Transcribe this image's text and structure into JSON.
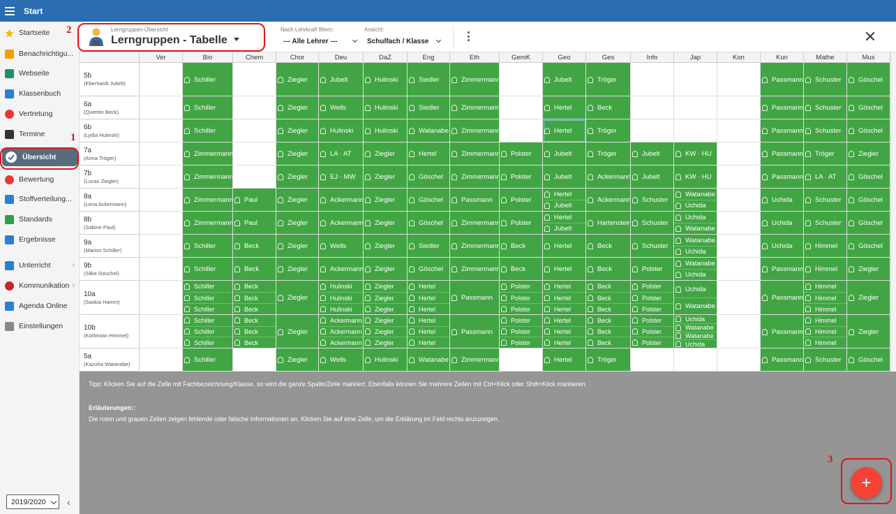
{
  "app": {
    "title": "Start"
  },
  "sidebar": {
    "items": [
      {
        "label": "Startseite",
        "icon": "star-icon",
        "color": "#f5b800"
      },
      {
        "label": "Benachrichtigu...",
        "icon": "envelope-icon",
        "color": "#f5a000"
      },
      {
        "label": "Webseite",
        "icon": "home-icon",
        "color": "#1f8f6f"
      },
      {
        "label": "Klassenbuch",
        "icon": "book-icon",
        "color": "#2a7fd0"
      },
      {
        "label": "Vertretung",
        "icon": "person-swap-icon",
        "color": "#e53935"
      },
      {
        "label": "Termine",
        "icon": "calendar-icon",
        "color": "#333333"
      },
      {
        "label": "Übersicht",
        "icon": "check-circle-icon",
        "color": "#ffffff",
        "active": true
      },
      {
        "label": "Bewertung",
        "icon": "grade-icon",
        "color": "#e53935"
      },
      {
        "label": "Stoffverteilung...",
        "icon": "layers-icon",
        "color": "#2a7fd0"
      },
      {
        "label": "Standards",
        "icon": "shield-icon",
        "color": "#2e9e47"
      },
      {
        "label": "Ergebnisse",
        "icon": "bar-chart-icon",
        "color": "#2a7fd0"
      },
      {
        "label": "Unterricht",
        "icon": "class-icon",
        "color": "#2a7fd0",
        "submenu": true
      },
      {
        "label": "Kommunikation",
        "icon": "chat-icon",
        "color": "#c62828",
        "submenu": true
      },
      {
        "label": "Agenda Online",
        "icon": "pen-icon",
        "color": "#2a7fd0"
      },
      {
        "label": "Einstellungen",
        "icon": "gear-icon",
        "color": "#888888"
      }
    ],
    "year": "2019/2020"
  },
  "toolbar": {
    "small_title": "Lerngruppen-Übersicht",
    "main_title": "Lerngruppen - Tabelle",
    "filter_label": "Nach Lehrkraft filtern:",
    "filter_value": "--- Alle Lehrer ---",
    "view_label": "Ansicht:",
    "view_value": "Schulfach / Klasse"
  },
  "annotations": [
    "1",
    "2",
    "3"
  ],
  "table": {
    "columns": [
      "Ver",
      "Bio",
      "Chem",
      "Chor",
      "Deu",
      "DaZ",
      "Eng",
      "Eth",
      "GemK",
      "Geo",
      "Ges",
      "Info",
      "Jap",
      "Kon",
      "Kun",
      "Mathe",
      "Mus"
    ],
    "rows": [
      {
        "class": "5b",
        "teacher": "(Eberhardt Jubelt)",
        "cells": [
          [],
          [
            "Schiller"
          ],
          [],
          [
            "Ziegler"
          ],
          [
            "Jubelt"
          ],
          [
            "Hulinski"
          ],
          [
            "Siedler"
          ],
          [
            "Zimmermann"
          ],
          [],
          [
            "Jubelt"
          ],
          [
            "Tröger"
          ],
          [],
          [],
          [],
          [
            "Passmann"
          ],
          [
            "Schuster"
          ],
          [
            "Göschel"
          ]
        ]
      },
      {
        "class": "6a",
        "teacher": "(Quentin Beck)",
        "cells": [
          [],
          [
            "Schiller"
          ],
          [],
          [
            "Ziegler"
          ],
          [
            "Wells"
          ],
          [
            "Hulinski"
          ],
          [
            "Siedler"
          ],
          [
            "Zimmermann"
          ],
          [],
          [
            "Hertel"
          ],
          [
            "Beck"
          ],
          [],
          [],
          [],
          [
            "Passmann"
          ],
          [
            "Schuster"
          ],
          [
            "Göschel"
          ]
        ]
      },
      {
        "class": "6b",
        "teacher": "(Lydia Hulinski)",
        "cells": [
          [],
          [
            "Schiller"
          ],
          [],
          [
            "Ziegler"
          ],
          [
            "Hulinski"
          ],
          [
            "Hulinski"
          ],
          [
            "Watanabe"
          ],
          [
            "Zimmermann"
          ],
          [],
          [
            "Hertel"
          ],
          [
            "Tröger"
          ],
          [],
          [],
          [],
          [
            "Passmann"
          ],
          [
            "Schuster"
          ],
          [
            "Göschel"
          ]
        ]
      },
      {
        "class": "7a",
        "teacher": "(Anna Tröger)",
        "cells": [
          [],
          [
            "Zimmermann"
          ],
          [],
          [
            "Ziegler"
          ],
          [
            "LA · AT"
          ],
          [
            "Ziegler"
          ],
          [
            "Hertel"
          ],
          [
            "Zimmermann"
          ],
          [
            "Polster"
          ],
          [
            "Jubelt"
          ],
          [
            "Tröger"
          ],
          [
            "Jubelt"
          ],
          [
            "KW · HU"
          ],
          [],
          [
            "Passmann"
          ],
          [
            "Tröger"
          ],
          [
            "Ziegler"
          ]
        ]
      },
      {
        "class": "7b",
        "teacher": "(Lucas Ziegler)",
        "cells": [
          [],
          [
            "Zimmermann"
          ],
          [],
          [
            "Ziegler"
          ],
          [
            "EJ · MW"
          ],
          [
            "Ziegler"
          ],
          [
            "Göschel"
          ],
          [
            "Zimmermann"
          ],
          [
            "Polster"
          ],
          [
            "Jubelt"
          ],
          [
            "Ackermann"
          ],
          [
            "Jubelt"
          ],
          [
            "KW · HU"
          ],
          [],
          [
            "Passmann"
          ],
          [
            "LA · AT"
          ],
          [
            "Göschel"
          ]
        ]
      },
      {
        "class": "8a",
        "teacher": "(Lena Ackermann)",
        "cells": [
          [],
          [
            "Zimmermann"
          ],
          [
            "Paul"
          ],
          [
            "Ziegler"
          ],
          [
            "Ackermann"
          ],
          [
            "Ziegler"
          ],
          [
            "Göschel"
          ],
          [
            "Passmann"
          ],
          [
            "Polster"
          ],
          [
            "Hertel",
            "Jubelt"
          ],
          [
            "Ackermann"
          ],
          [
            "Schuster"
          ],
          [
            "Watanabe",
            "Uchida"
          ],
          [],
          [
            "Uchida"
          ],
          [
            "Schuster"
          ],
          [
            "Göschel"
          ]
        ]
      },
      {
        "class": "8b",
        "teacher": "(Sabine Paul)",
        "cells": [
          [],
          [
            "Zimmermann"
          ],
          [
            "Paul"
          ],
          [
            "Ziegler"
          ],
          [
            "Ackermann"
          ],
          [
            "Ziegler"
          ],
          [
            "Göschel"
          ],
          [
            "Zimmermann"
          ],
          [
            "Polster"
          ],
          [
            "Hertel",
            "Jubelt"
          ],
          [
            "Hartenstein"
          ],
          [
            "Schuster"
          ],
          [
            "Uchida",
            "Watanabe"
          ],
          [],
          [
            "Uchida"
          ],
          [
            "Schuster"
          ],
          [
            "Göschel"
          ]
        ]
      },
      {
        "class": "9a",
        "teacher": "(Marion Schiller)",
        "cells": [
          [],
          [
            "Schiller"
          ],
          [
            "Beck"
          ],
          [
            "Ziegler"
          ],
          [
            "Wells"
          ],
          [
            "Ziegler"
          ],
          [
            "Siedler"
          ],
          [
            "Zimmermann"
          ],
          [
            "Beck"
          ],
          [
            "Hertel"
          ],
          [
            "Beck"
          ],
          [
            "Schuster"
          ],
          [
            "Watanabe",
            "Uchida"
          ],
          [],
          [
            "Uchida"
          ],
          [
            "Himmel"
          ],
          [
            "Göschel"
          ]
        ]
      },
      {
        "class": "9b",
        "teacher": "(Silke Göschel)",
        "cells": [
          [],
          [
            "Schiller"
          ],
          [
            "Beck"
          ],
          [
            "Ziegler"
          ],
          [
            "Ackermann"
          ],
          [
            "Ziegler"
          ],
          [
            "Göschel"
          ],
          [
            "Zimmermann"
          ],
          [
            "Beck"
          ],
          [
            "Hertel"
          ],
          [
            "Beck"
          ],
          [
            "Polster"
          ],
          [
            "Watanabe",
            "Uchida"
          ],
          [],
          [
            "Passmann"
          ],
          [
            "Himmel"
          ],
          [
            "Ziegler"
          ]
        ]
      },
      {
        "class": "10a",
        "teacher": "(Saskia Hamm)",
        "cells": [
          [],
          [
            "Schiller",
            "Schiller",
            "Schiller"
          ],
          [
            "Beck",
            "Beck",
            "Beck"
          ],
          [
            "Ziegler"
          ],
          [
            "Hulinski",
            "Hulinski",
            "Hulinski"
          ],
          [
            "Ziegler",
            "Ziegler",
            "Ziegler"
          ],
          [
            "Hertel",
            "Hertel",
            "Hertel"
          ],
          [
            "Passmann"
          ],
          [
            "Polster",
            "Polster",
            "Polster"
          ],
          [
            "Hertel",
            "Hertel",
            "Hertel"
          ],
          [
            "Beck",
            "Beck",
            "Beck"
          ],
          [
            "Polster",
            "Polster",
            "Polster"
          ],
          [
            "Uchida",
            "Watanabe"
          ],
          [],
          [
            "Passmann"
          ],
          [
            "Himmel",
            "Himmel",
            "Himmel"
          ],
          [
            "Ziegler"
          ]
        ]
      },
      {
        "class": "10b",
        "teacher": "(Korbinian Himmel)",
        "cells": [
          [],
          [
            "Schiller",
            "Schiller",
            "Schiller"
          ],
          [
            "Beck",
            "Beck",
            "Beck"
          ],
          [
            "Ziegler"
          ],
          [
            "Ackermann",
            "Ackermann",
            "Ackermann"
          ],
          [
            "Ziegler",
            "Ziegler",
            "Ziegler"
          ],
          [
            "Hertel",
            "Hertel",
            "Hertel"
          ],
          [
            "Passmann"
          ],
          [
            "Polster",
            "Polster",
            "Polster"
          ],
          [
            "Hertel",
            "Hertel",
            "Hertel"
          ],
          [
            "Beck",
            "Beck",
            "Beck"
          ],
          [
            "Polster",
            "Polster",
            "Polster"
          ],
          [
            "Uchida",
            "Watanabe",
            "Watanabe",
            "Uchida"
          ],
          [],
          [
            "Passmann"
          ],
          [
            "Himmel",
            "Himmel",
            "Himmel"
          ],
          [
            "Ziegler"
          ]
        ]
      },
      {
        "class": "5a",
        "teacher": "(Kazuha Watanabe)",
        "cells": [
          [],
          [
            "Schiller"
          ],
          [],
          [
            "Ziegler"
          ],
          [
            "Wells"
          ],
          [
            "Hulinski"
          ],
          [
            "Watanabe"
          ],
          [
            "Zimmermann"
          ],
          [],
          [
            "Hertel"
          ],
          [
            "Tröger"
          ],
          [],
          [],
          [],
          [
            "Passmann"
          ],
          [
            "Schuster"
          ],
          [
            "Göschel"
          ]
        ]
      }
    ]
  },
  "info": {
    "tip": "Tipp: Klicken Sie auf die Zelle mit Fachbezeichnung/Klasse, so wird die ganze Spalte/Zeile markiert. Ebenfalls können Sie mehrere Zellen mit Ctrl+Klick oder Shift+Klick markieren.",
    "erl_title": "Erläuterungen::",
    "erl_text": "Die roten und grauen Zellen zeigen fehlende oder falsche Informationen an. Klicken Sie auf eine Zelle, um die Erklärung im Feld rechts anzuzeigen."
  },
  "fab": {
    "label": "+"
  }
}
